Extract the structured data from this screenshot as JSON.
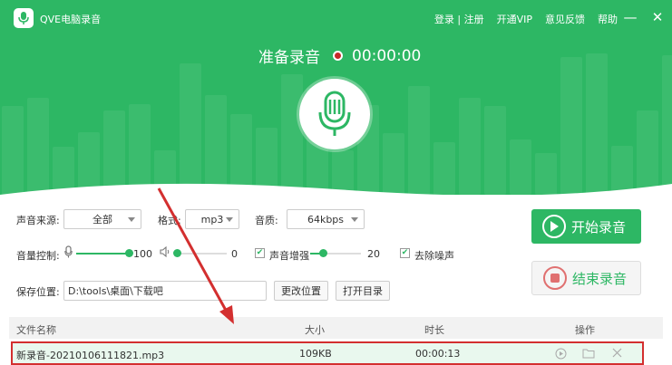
{
  "app": {
    "title": "QVE电脑录音"
  },
  "titlebar": {
    "login": "登录",
    "sep": "|",
    "register": "注册",
    "vip": "开通VIP",
    "feedback": "意见反馈",
    "help": "帮助",
    "minimize": "—",
    "close": "✕"
  },
  "status": {
    "label": "准备录音",
    "time": "00:00:00"
  },
  "controls": {
    "source_label": "声音来源:",
    "source_value": "全部",
    "format_label": "格式:",
    "format_value": "mp3",
    "quality_label": "音质:",
    "quality_value": "64kbps",
    "volume_label": "音量控制:",
    "mic_volume": "100",
    "speaker_volume": "0",
    "boost_label": "声音增强",
    "boost_value": "20",
    "denoise_label": "去除噪声",
    "save_label": "保存位置:",
    "save_path": "D:\\tools\\桌面\\下载吧",
    "change_button": "更改位置",
    "open_button": "打开目录",
    "start_button": "开始录音",
    "stop_button": "结束录音"
  },
  "table": {
    "headers": [
      "文件名称",
      "大小",
      "时长",
      "操作"
    ],
    "rows": [
      {
        "name": "新录音-20210106111821.mp3",
        "size": "109KB",
        "duration": "00:00:13"
      }
    ]
  },
  "colors": {
    "accent": "#2db764",
    "highlight": "#d32f2f"
  }
}
